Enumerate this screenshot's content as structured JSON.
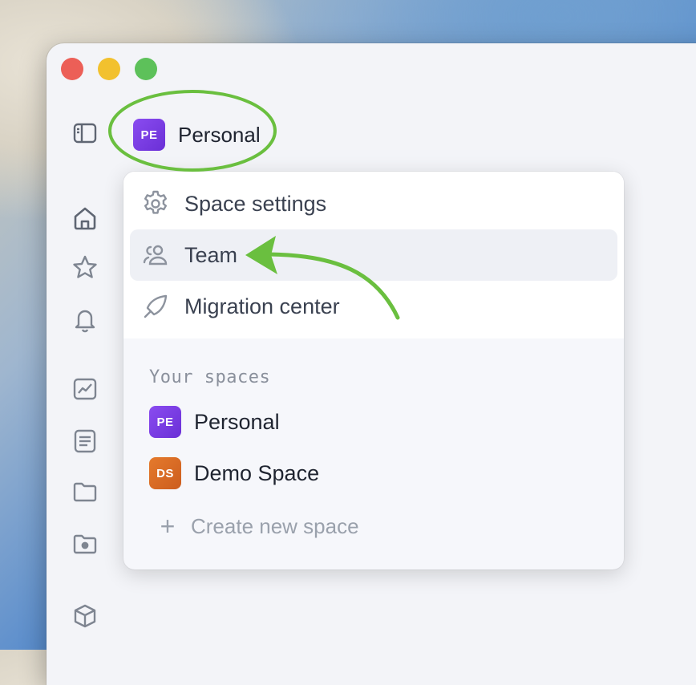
{
  "window": {
    "traffic_lights": [
      "close",
      "minimize",
      "maximize"
    ]
  },
  "header": {
    "space_badge": "PE",
    "space_name": "Personal",
    "badge_color": "#7b3fe4"
  },
  "sidebar": {
    "icons": [
      "sidebar-toggle-icon",
      "home-icon",
      "star-icon",
      "bell-icon",
      "chart-icon",
      "document-icon",
      "folder-icon",
      "shared-folder-icon",
      "cube-icon"
    ]
  },
  "menu": {
    "items": [
      {
        "label": "Space settings",
        "icon": "gear-icon"
      },
      {
        "label": "Team",
        "icon": "team-icon"
      },
      {
        "label": "Migration center",
        "icon": "migration-icon"
      }
    ],
    "spaces_heading": "Your spaces",
    "spaces": [
      {
        "badge": "PE",
        "name": "Personal",
        "color": "#7b3fe4"
      },
      {
        "badge": "DS",
        "name": "Demo Space",
        "color": "#d96a24"
      }
    ],
    "create_label": "Create new space"
  },
  "annotation": {
    "color": "#6abf3f"
  }
}
